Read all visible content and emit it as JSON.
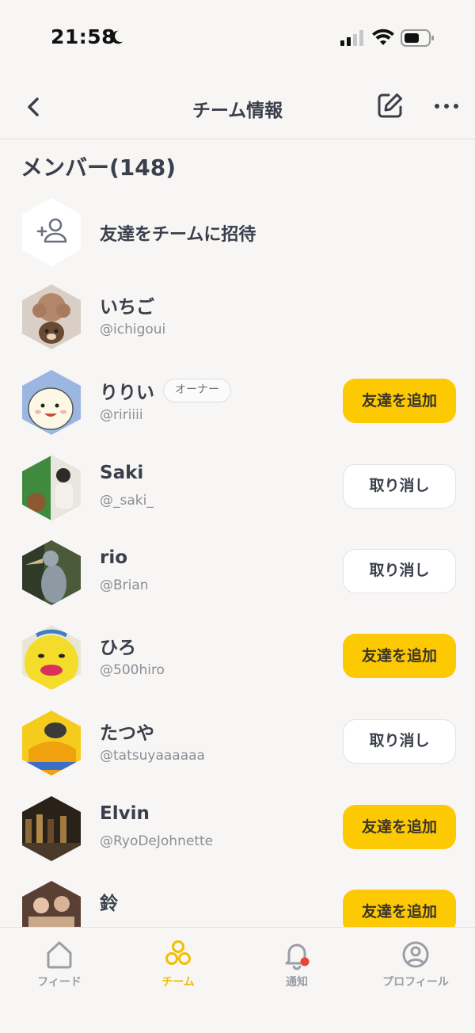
{
  "status_bar": {
    "time": "21:58"
  },
  "header": {
    "title": "チーム情報"
  },
  "members_section": {
    "title": "メンバー(148)",
    "invite_label": "友達をチームに招待"
  },
  "members": [
    {
      "name": "いちご",
      "handle": "@ichigoui",
      "avatar": "poodle-avatar"
    },
    {
      "name": "りりい",
      "handle": "@ririiii",
      "badge": "オーナー",
      "button": "友達を追加",
      "avatar": "chick-avatar"
    },
    {
      "name": "Saki",
      "handle": "@_saki_",
      "button": "取り消し",
      "avatar": "photo-avatar"
    },
    {
      "name": "rio",
      "handle": "@Brian",
      "button": "取り消し",
      "avatar": "bird-avatar"
    },
    {
      "name": "ひろ",
      "handle": "@500hiro",
      "button": "友達を追加",
      "avatar": "yellow-character-avatar"
    },
    {
      "name": "たつや",
      "handle": "@tatsuyaaaaaa",
      "button": "取り消し",
      "avatar": "motion-avatar"
    },
    {
      "name": "Elvin",
      "handle": "@RyoDeJohnette",
      "button": "友達を追加",
      "avatar": "bar-avatar"
    },
    {
      "name": "鈴",
      "handle": "",
      "button": "友達を追加",
      "avatar": "people-avatar"
    }
  ],
  "tab_bar": {
    "tabs": [
      {
        "label": "フィード",
        "icon": "home-icon"
      },
      {
        "label": "チーム",
        "icon": "team-icon",
        "active": true
      },
      {
        "label": "通知",
        "icon": "bell-icon"
      },
      {
        "label": "プロフィール",
        "icon": "profile-icon"
      }
    ]
  },
  "colors": {
    "accent": "#fcc902",
    "text": "#3a3f4b",
    "muted": "#8a8e96",
    "notification_dot": "#e8443a"
  }
}
